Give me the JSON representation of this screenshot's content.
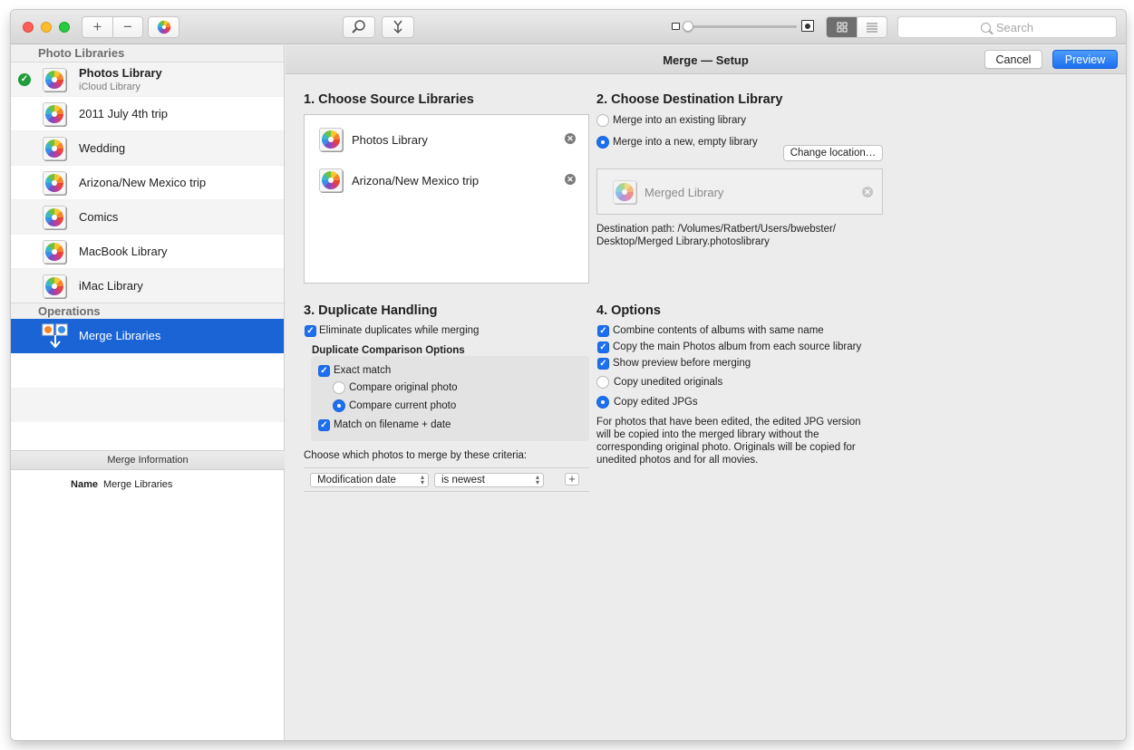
{
  "toolbar": {
    "add_symbol": "+",
    "remove_symbol": "−",
    "search_placeholder": "Search"
  },
  "sidebar": {
    "libraries_header": "Photo Libraries",
    "libraries": [
      {
        "name": "Photos Library",
        "subtitle": "iCloud Library",
        "active": true
      },
      {
        "name": "2011 July 4th trip"
      },
      {
        "name": "Wedding"
      },
      {
        "name": "Arizona/New Mexico trip"
      },
      {
        "name": "Comics"
      },
      {
        "name": "MacBook Library"
      },
      {
        "name": "iMac Library"
      }
    ],
    "operations_header": "Operations",
    "operations": [
      {
        "name": "Merge Libraries",
        "selected": true
      }
    ],
    "info_header": "Merge Information",
    "info": {
      "key": "Name",
      "value": "Merge Libraries"
    }
  },
  "main": {
    "title": "Merge — Setup",
    "cancel_label": "Cancel",
    "preview_label": "Preview",
    "section1": {
      "heading": "1. Choose Source Libraries",
      "sources": [
        "Photos Library",
        "Arizona/New Mexico trip"
      ]
    },
    "section2": {
      "heading": "2. Choose Destination Library",
      "option_existing": "Merge into an existing library",
      "option_new": "Merge into a new, empty library",
      "selected": "new",
      "change_location_label": "Change location…",
      "destination_name": "Merged Library",
      "destination_path": "Destination path: /Volumes/Ratbert/Users/bwebster/ Desktop/Merged Library.photoslibrary"
    },
    "section3": {
      "heading": "3. Duplicate Handling",
      "eliminate_label": "Eliminate duplicates while merging",
      "comparison_header": "Duplicate Comparison Options",
      "exact_match_label": "Exact match",
      "compare_original_label": "Compare original photo",
      "compare_current_label": "Compare current photo",
      "filename_date_label": "Match on filename + date",
      "criteria_label": "Choose which photos to merge by these criteria:",
      "criteria_field": "Modification date",
      "criteria_rule": "is newest",
      "add_symbol": "+"
    },
    "section4": {
      "heading": "4. Options",
      "combine_albums_label": "Combine contents of albums with same name",
      "copy_main_album_label": "Copy the main Photos album from each source library",
      "show_preview_label": "Show preview before merging",
      "copy_unedited_label": "Copy unedited originals",
      "copy_edited_label": "Copy edited JPGs",
      "note": "For photos that have been edited, the edited JPG version will be copied into the merged library without the corresponding original photo. Originals will be copied for unedited photos and for all movies."
    }
  },
  "colors": {
    "accent": "#1c6ff0",
    "selection": "#1a64d6",
    "check_green": "#1f9d3b"
  }
}
